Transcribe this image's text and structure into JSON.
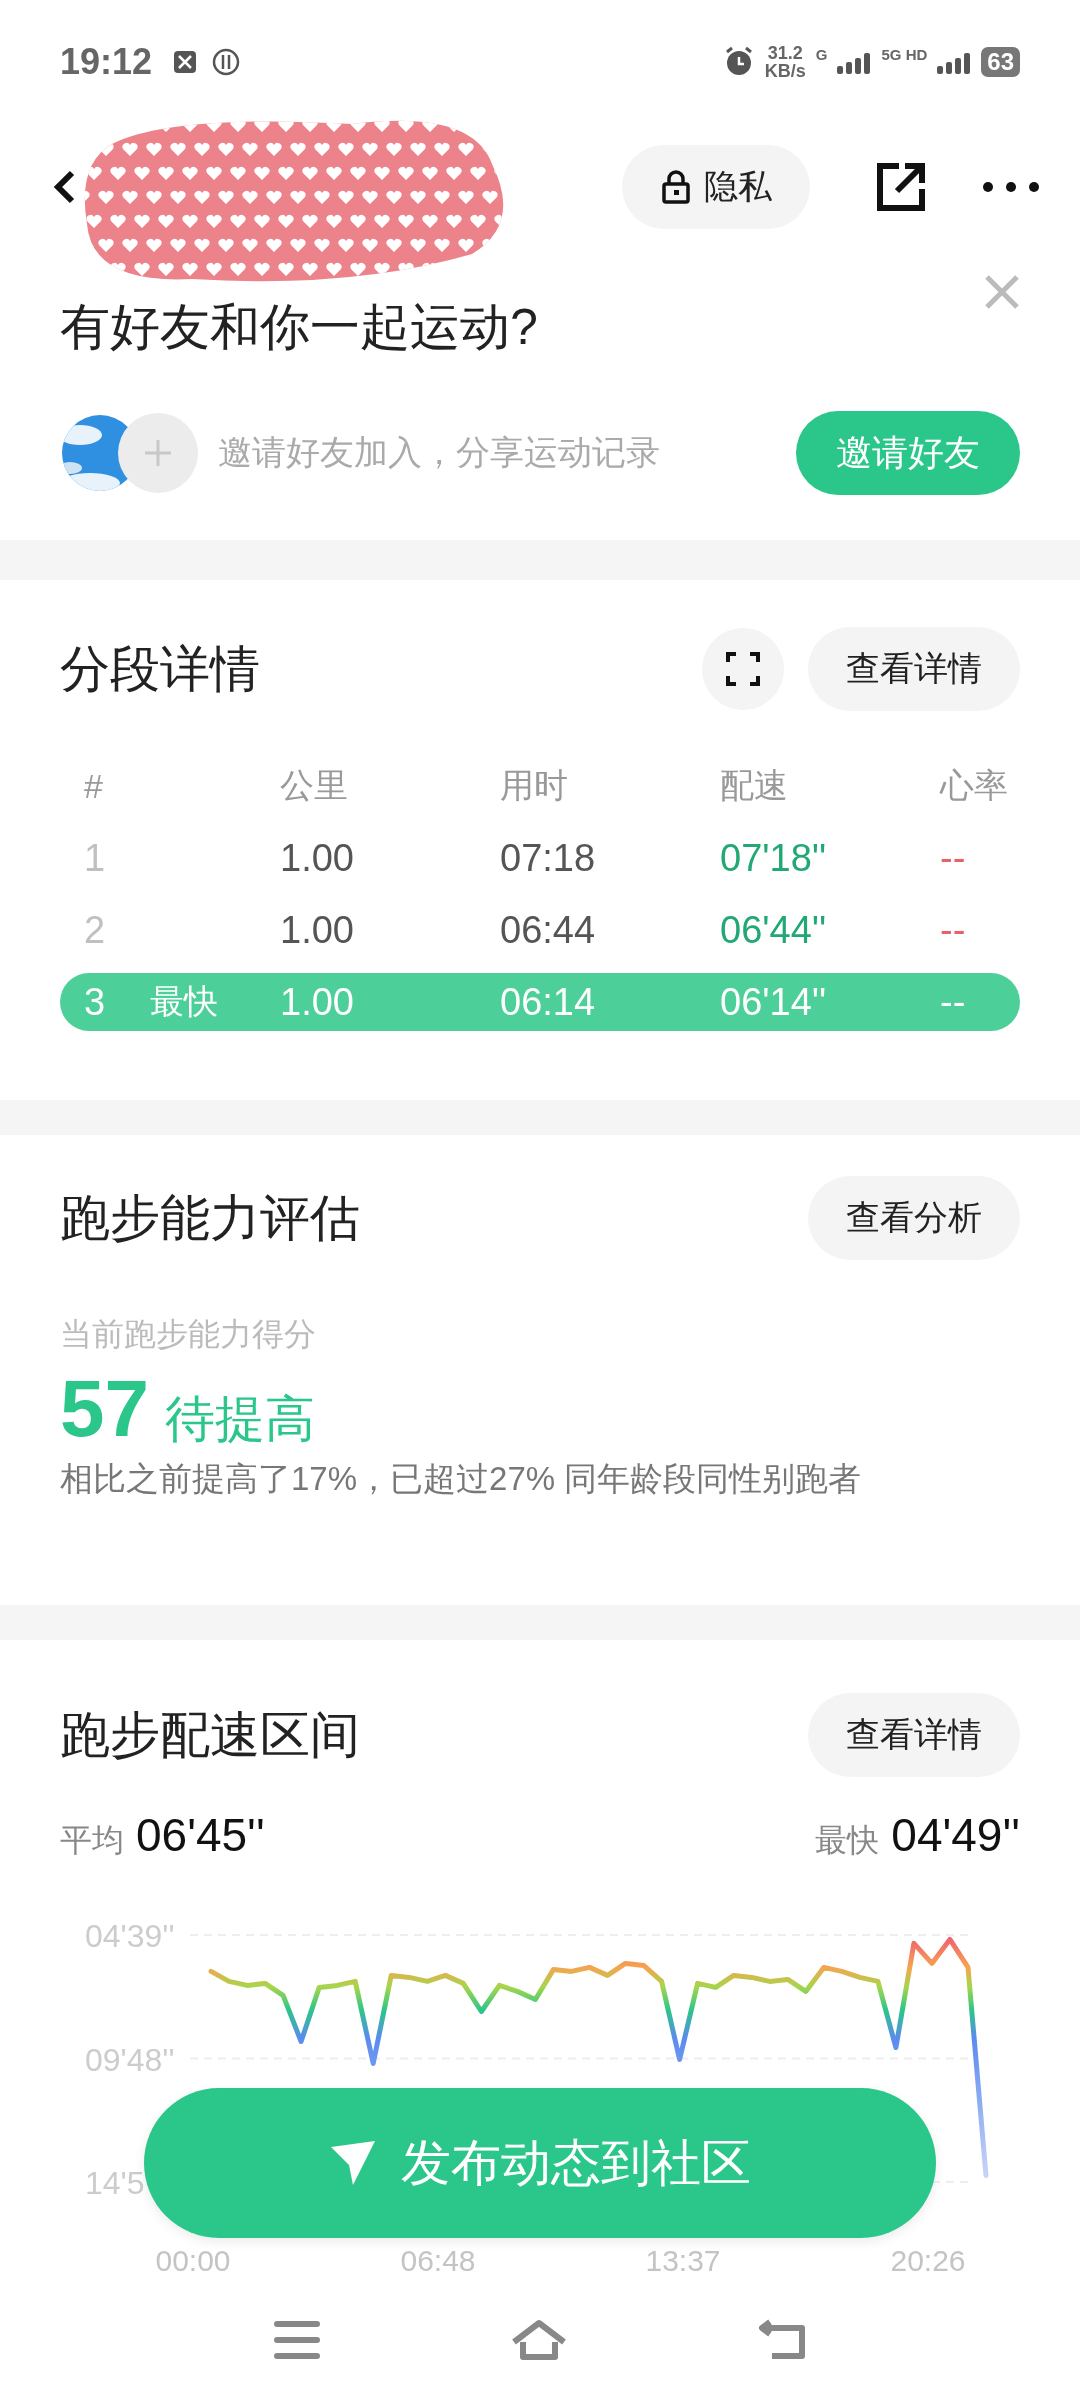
{
  "status_bar": {
    "time": "19:12",
    "speed_value": "31.2",
    "speed_unit": "KB/s",
    "sim1": "G",
    "sim2": "5G HD",
    "battery": "63"
  },
  "header": {
    "privacy_button": "隐私"
  },
  "invite": {
    "title": "有好友和你一起运动?",
    "hint": "邀请好友加入，分享运动记录",
    "button": "邀请好友"
  },
  "splits": {
    "title": "分段详情",
    "button": "查看详情",
    "columns": [
      "#",
      "公里",
      "用时",
      "配速",
      "心率"
    ],
    "rows": [
      {
        "index": "1",
        "distance": "1.00",
        "time": "07:18",
        "pace": "07'18''",
        "heart_rate": "--",
        "highlighted": false
      },
      {
        "index": "2",
        "distance": "1.00",
        "time": "06:44",
        "pace": "06'44''",
        "heart_rate": "--",
        "highlighted": false
      },
      {
        "index": "3",
        "badge": "最快",
        "distance": "1.00",
        "time": "06:14",
        "pace": "06'14''",
        "heart_rate": "--",
        "highlighted": true
      }
    ]
  },
  "ability": {
    "title": "跑步能力评估",
    "button": "查看分析",
    "label": "当前跑步能力得分",
    "score": "57",
    "rating": "待提高",
    "summary": "相比之前提高了17%，已超过27% 同年龄段同性别跑者"
  },
  "pace_zones": {
    "title": "跑步配速区间",
    "button": "查看详情",
    "average_label": "平均",
    "average": "06'45''",
    "fastest_label": "最快",
    "fastest": "04'49''",
    "y_axis_labels": [
      "04'39''",
      "09'48''",
      "14'5"
    ],
    "x_axis_labels": [
      "00:00",
      "06:48",
      "13:37",
      "20:26"
    ]
  },
  "publish_button": "发布动态到社区"
}
